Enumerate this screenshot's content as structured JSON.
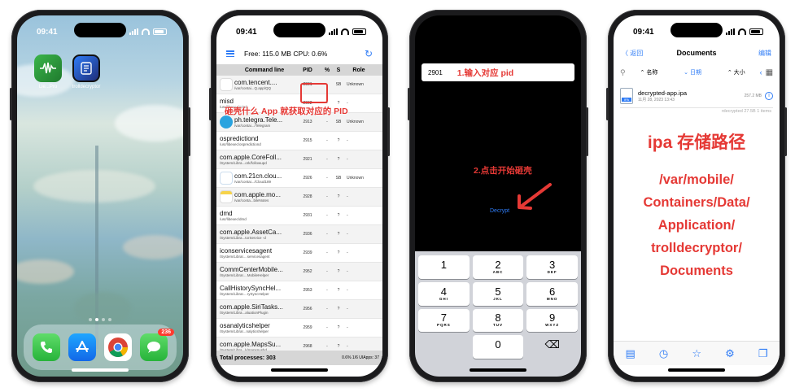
{
  "status_time": "09:41",
  "phone1": {
    "apps": [
      {
        "label": "Lie...Pro",
        "icon": "waveform-app-icon"
      },
      {
        "label": "trolldecryptor",
        "icon": "trolldecryptor-app-icon"
      }
    ],
    "dock": [
      {
        "icon": "phone-app-icon"
      },
      {
        "icon": "app-store-icon"
      },
      {
        "icon": "chrome-app-icon"
      },
      {
        "icon": "messages-app-icon",
        "badge": "236"
      }
    ]
  },
  "phone2": {
    "toolbar": {
      "stats": "Free: 115.0 MB  CPU: 0.6%"
    },
    "headers": {
      "command": "Command line",
      "pid": "PID",
      "pct": "%",
      "s": "S",
      "role": "Role"
    },
    "annotation": "砸壳什么 App 就获取对应的 PID",
    "rows": [
      {
        "name": "com.tencent....",
        "path": "/var/contai...Q.app/QQ",
        "pid": "2901",
        "pct": "-",
        "s": "SB",
        "role": "Unknown",
        "icon": "qq-icon"
      },
      {
        "name": "misd",
        "path": "/usr/libexec/misd",
        "pid": "2902",
        "pct": "-",
        "s": "?",
        "role": "-",
        "icon": ""
      },
      {
        "name": "ph.telegra.Tele...",
        "path": "/var/contai.../Telegram",
        "pid": "2913",
        "pct": "-",
        "s": "SB",
        "role": "Unknown",
        "icon": "telegram-icon"
      },
      {
        "name": "ospredictiond",
        "path": "/usr/libexec/ospredictiond",
        "pid": "2915",
        "pct": "-",
        "s": "?",
        "role": "-",
        "icon": ""
      },
      {
        "name": "com.apple.CoreFoll...",
        "path": "/System/Libra...ork/followupd",
        "pid": "2921",
        "pct": "-",
        "s": "?",
        "role": "-",
        "icon": ""
      },
      {
        "name": "com.21cn.clou...",
        "path": "/var/contai.../Cloud189",
        "pid": "2926",
        "pct": "-",
        "s": "SB",
        "role": "Unknown",
        "icon": "cloud-icon"
      },
      {
        "name": "com.apple.mo...",
        "path": "/var/conta...bileNotes",
        "pid": "2928",
        "pct": "-",
        "s": "?",
        "role": "-",
        "icon": "notes-icon"
      },
      {
        "name": "dmd",
        "path": "/usr/libexec/dmd",
        "pid": "2931",
        "pct": "-",
        "s": "?",
        "role": "-",
        "icon": ""
      },
      {
        "name": "com.apple.AssetCa...",
        "path": "/System/Libra...torService -d",
        "pid": "2936",
        "pct": "-",
        "s": "?",
        "role": "-",
        "icon": ""
      },
      {
        "name": "iconservicesagent",
        "path": "/System/Librar....servicesagent",
        "pid": "2939",
        "pct": "-",
        "s": "?",
        "role": "-",
        "icon": ""
      },
      {
        "name": "CommCenterMobile...",
        "path": "/System/Librar....MobileHelper",
        "pid": "2952",
        "pct": "-",
        "s": "?",
        "role": "-",
        "icon": ""
      },
      {
        "name": "CallHistorySyncHel...",
        "path": "/System/Librar....rySyncHelper",
        "pid": "2953",
        "pct": "-",
        "s": "?",
        "role": "-",
        "icon": ""
      },
      {
        "name": "com.apple.SiriTasks...",
        "path": "/System/Libra...aluationPlugin",
        "pid": "2956",
        "pct": "-",
        "s": "?",
        "role": "-",
        "icon": ""
      },
      {
        "name": "osanalyticshelper",
        "path": "/System/Librar...nalyticshelper",
        "pid": "2959",
        "pct": "-",
        "s": "?",
        "role": "-",
        "icon": ""
      },
      {
        "name": "com.apple.MapsSu...",
        "path": "/System/Libra...k/mapspushd",
        "pid": "2968",
        "pct": "-",
        "s": "?",
        "role": "-",
        "icon": ""
      }
    ],
    "footer": {
      "total": "Total processes: 303",
      "stats": "0.6% 1/6        UIApps: 37"
    }
  },
  "phone3": {
    "input_value": "2901",
    "step1": "1.输入对应 pid",
    "step2": "2.点击开始砸壳",
    "decrypt_label": "Decrypt",
    "keys": [
      {
        "n": "1",
        "l": ""
      },
      {
        "n": "2",
        "l": "ABC"
      },
      {
        "n": "3",
        "l": "DEF"
      },
      {
        "n": "4",
        "l": "GHI"
      },
      {
        "n": "5",
        "l": "JKL"
      },
      {
        "n": "6",
        "l": "MNO"
      },
      {
        "n": "7",
        "l": "PQRS"
      },
      {
        "n": "8",
        "l": "TUV"
      },
      {
        "n": "9",
        "l": "WXYZ"
      },
      {
        "n": "",
        "l": ""
      },
      {
        "n": "0",
        "l": ""
      },
      {
        "n": "⌫",
        "l": ""
      }
    ]
  },
  "phone4": {
    "back": "〈 返回",
    "title": "Documents",
    "edit": "编辑",
    "sort": {
      "name": "⌃ 名称",
      "date": "⌄ 日期",
      "size": "⌃ 大小"
    },
    "file": {
      "name": "decrypted-app.ipa",
      "date": "11月 28, 2023 13:43",
      "size": "257.2 MB",
      "badge": "IPA"
    },
    "free": "rdecrypted 27.5B   1 items",
    "heading": "ipa 存储路径",
    "path_lines": [
      "/var/mobile/",
      "Containers/Data/",
      "Application/",
      "trolldecryptor/",
      "Documents"
    ]
  }
}
